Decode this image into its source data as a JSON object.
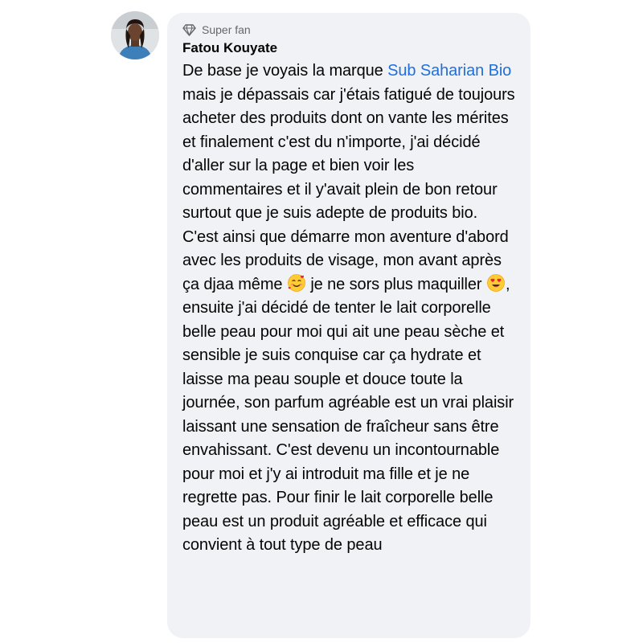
{
  "comment": {
    "author": {
      "name": "Fatou Kouyate",
      "badge_label": "Super fan",
      "badge_icon": "diamond-icon",
      "avatar": "profile-photo"
    },
    "segments": {
      "t1": "De base je voyais la marque ",
      "brand": "Sub Saharian Bio",
      "t2": " mais je dépassais car j'étais fatigué de toujours acheter des produits dont on vante les mérites et finalement c'est du n'importe, j'ai décidé d'aller sur la page et bien voir les commentaires et il y'avait plein de bon retour surtout que je suis adepte de produits bio. C'est ainsi que démarre mon aventure d'abord avec les produits de visage, mon avant après ça djaa même ",
      "emoji1": "smiling-face-with-hearts",
      "t3": " je ne sors plus maquiller ",
      "emoji2": "heart-eyes",
      "t4": ", ensuite j'ai décidé de tenter le lait corporelle belle peau pour moi qui ait une peau sèche et sensible je suis conquise car ça hydrate et laisse ma peau souple et douce toute la journée, son parfum agréable est un vrai plaisir laissant une sensation de fraîcheur sans être envahissant. C'est devenu un incontournable pour moi et j'y ai introduit ma fille et je ne regrette pas. Pour finir le lait corporelle belle peau est un produit agréable et efficace qui convient à tout type de peau"
    }
  },
  "colors": {
    "bubble_bg": "#f0f2f5",
    "text": "#050505",
    "secondary_text": "#65676b",
    "link": "#216fdb"
  }
}
